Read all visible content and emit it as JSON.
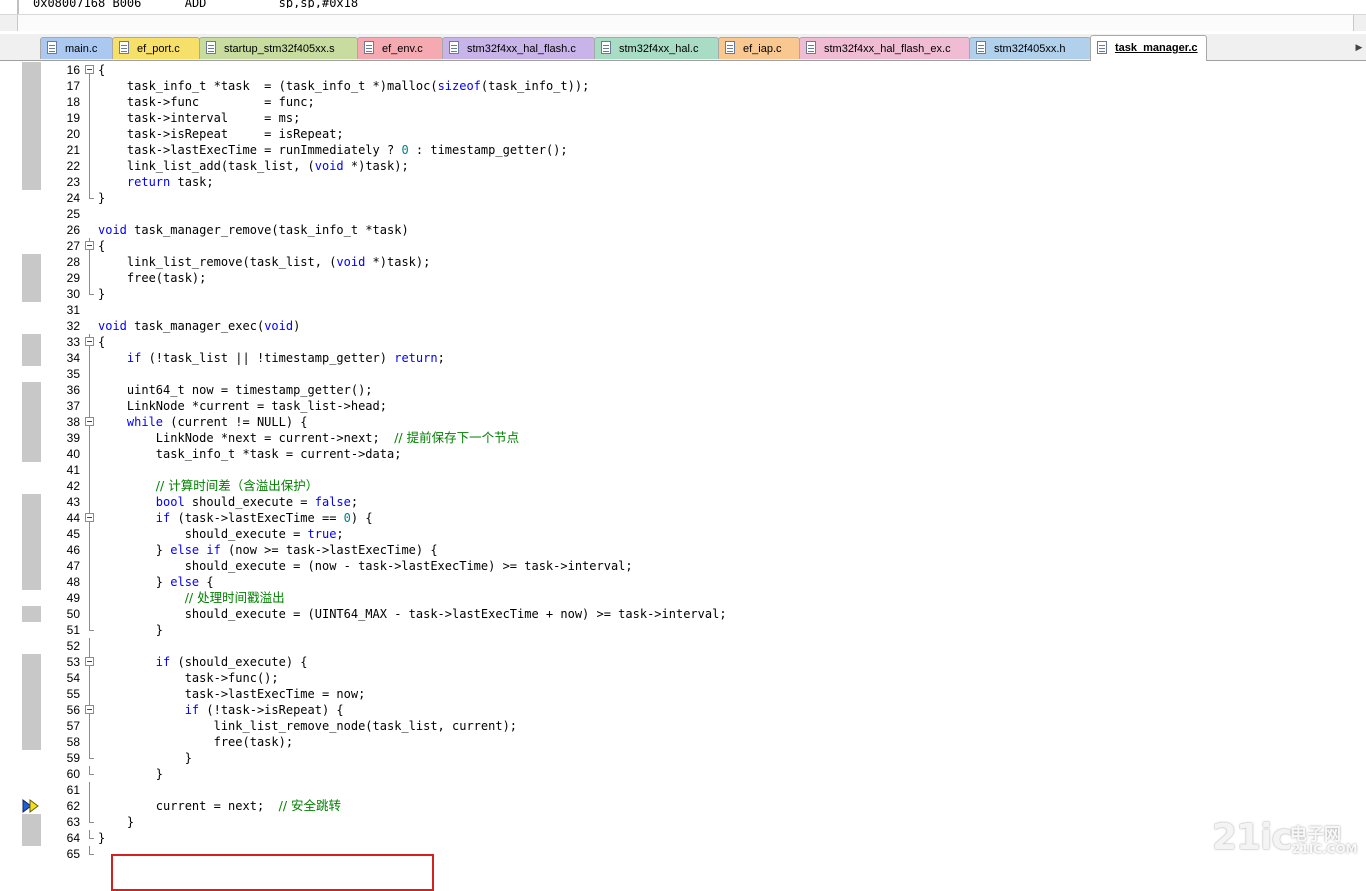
{
  "disassembly": {
    "line": "0x08007168 B006      ADD          sp,sp,#0x18"
  },
  "tabs": [
    {
      "label": "main.c",
      "color": "#aac8f0",
      "active": false
    },
    {
      "label": "ef_port.c",
      "color": "#f7e06a",
      "active": false
    },
    {
      "label": "startup_stm32f405xx.s",
      "color": "#c8dca0",
      "active": false
    },
    {
      "label": "ef_env.c",
      "color": "#f4aab0",
      "active": false
    },
    {
      "label": "stm32f4xx_hal_flash.c",
      "color": "#c8b4e8",
      "active": false
    },
    {
      "label": "stm32f4xx_hal.c",
      "color": "#a8dcc4",
      "active": false
    },
    {
      "label": "ef_iap.c",
      "color": "#f8c890",
      "active": false
    },
    {
      "label": "stm32f4xx_hal_flash_ex.c",
      "color": "#f0bcd4",
      "active": false
    },
    {
      "label": "stm32f405xx.h",
      "color": "#b0d0ec",
      "active": false
    },
    {
      "label": "task_manager.c",
      "color": "#ffffff",
      "active": true
    }
  ],
  "tab_scroll_glyph": "▶",
  "editor": {
    "lines": [
      {
        "n": "16",
        "mark": true,
        "fold": "box",
        "code": [
          [
            "t",
            "{"
          ]
        ]
      },
      {
        "n": "17",
        "mark": true,
        "fold": "line",
        "code": [
          [
            "t",
            "    task_info_t *task  = (task_info_t *)malloc("
          ],
          [
            "k",
            "sizeof"
          ],
          [
            "t",
            "(task_info_t));"
          ]
        ]
      },
      {
        "n": "18",
        "mark": true,
        "fold": "line",
        "code": [
          [
            "t",
            "    task->func         = func;"
          ]
        ]
      },
      {
        "n": "19",
        "mark": true,
        "fold": "line",
        "code": [
          [
            "t",
            "    task->interval     = ms;"
          ]
        ]
      },
      {
        "n": "20",
        "mark": true,
        "fold": "line",
        "code": [
          [
            "t",
            "    task->isRepeat     = isRepeat;"
          ]
        ]
      },
      {
        "n": "21",
        "mark": true,
        "fold": "line",
        "code": [
          [
            "t",
            "    task->lastExecTime = runImmediately ? "
          ],
          [
            "d",
            "0"
          ],
          [
            "t",
            " : timestamp_getter();"
          ]
        ]
      },
      {
        "n": "22",
        "mark": true,
        "fold": "line",
        "code": [
          [
            "t",
            "    link_list_add(task_list, ("
          ],
          [
            "k",
            "void"
          ],
          [
            "t",
            " *)task);"
          ]
        ]
      },
      {
        "n": "23",
        "mark": true,
        "fold": "line",
        "code": [
          [
            "t",
            "    "
          ],
          [
            "k",
            "return"
          ],
          [
            "t",
            " task;"
          ]
        ]
      },
      {
        "n": "24",
        "mark": false,
        "fold": "end",
        "code": [
          [
            "t",
            "}"
          ]
        ]
      },
      {
        "n": "25",
        "mark": false,
        "fold": "",
        "code": []
      },
      {
        "n": "26",
        "mark": false,
        "fold": "",
        "code": [
          [
            "k",
            "void"
          ],
          [
            "t",
            " task_manager_remove(task_info_t *task)"
          ]
        ]
      },
      {
        "n": "27",
        "mark": false,
        "fold": "box",
        "code": [
          [
            "t",
            "{"
          ]
        ]
      },
      {
        "n": "28",
        "mark": true,
        "fold": "line",
        "code": [
          [
            "t",
            "    link_list_remove(task_list, ("
          ],
          [
            "k",
            "void"
          ],
          [
            "t",
            " *)task);"
          ]
        ]
      },
      {
        "n": "29",
        "mark": true,
        "fold": "line",
        "code": [
          [
            "t",
            "    free(task);"
          ]
        ]
      },
      {
        "n": "30",
        "mark": true,
        "fold": "end",
        "code": [
          [
            "t",
            "}"
          ]
        ]
      },
      {
        "n": "31",
        "mark": false,
        "fold": "",
        "code": []
      },
      {
        "n": "32",
        "mark": false,
        "fold": "",
        "code": [
          [
            "k",
            "void"
          ],
          [
            "t",
            " task_manager_exec("
          ],
          [
            "k",
            "void"
          ],
          [
            "t",
            ")"
          ]
        ]
      },
      {
        "n": "33",
        "mark": true,
        "fold": "box",
        "code": [
          [
            "t",
            "{"
          ]
        ]
      },
      {
        "n": "34",
        "mark": true,
        "fold": "line",
        "code": [
          [
            "t",
            "    "
          ],
          [
            "k",
            "if"
          ],
          [
            "t",
            " (!task_list || !timestamp_getter) "
          ],
          [
            "k",
            "return"
          ],
          [
            "t",
            ";"
          ]
        ]
      },
      {
        "n": "35",
        "mark": false,
        "fold": "line",
        "code": []
      },
      {
        "n": "36",
        "mark": true,
        "fold": "line",
        "code": [
          [
            "t",
            "    uint64_t now = timestamp_getter();"
          ]
        ]
      },
      {
        "n": "37",
        "mark": true,
        "fold": "line",
        "code": [
          [
            "t",
            "    LinkNode *current = task_list->head;"
          ]
        ]
      },
      {
        "n": "38",
        "mark": true,
        "fold": "box",
        "code": [
          [
            "t",
            "    "
          ],
          [
            "k",
            "while"
          ],
          [
            "t",
            " (current != NULL) {"
          ]
        ]
      },
      {
        "n": "39",
        "mark": true,
        "fold": "line",
        "code": [
          [
            "t",
            "        LinkNode *next = current->next;  "
          ],
          [
            "c",
            "// 提前保存下一个节点"
          ]
        ]
      },
      {
        "n": "40",
        "mark": true,
        "fold": "line",
        "code": [
          [
            "t",
            "        task_info_t *task = current->data;"
          ]
        ]
      },
      {
        "n": "41",
        "mark": false,
        "fold": "line",
        "code": []
      },
      {
        "n": "42",
        "mark": false,
        "fold": "line",
        "code": [
          [
            "t",
            "        "
          ],
          [
            "c",
            "// 计算时间差（含溢出保护）"
          ]
        ]
      },
      {
        "n": "43",
        "mark": true,
        "fold": "line",
        "code": [
          [
            "t",
            "        "
          ],
          [
            "k",
            "bool"
          ],
          [
            "t",
            " should_execute = "
          ],
          [
            "k",
            "false"
          ],
          [
            "t",
            ";"
          ]
        ]
      },
      {
        "n": "44",
        "mark": true,
        "fold": "box",
        "code": [
          [
            "t",
            "        "
          ],
          [
            "k",
            "if"
          ],
          [
            "t",
            " (task->lastExecTime == "
          ],
          [
            "d",
            "0"
          ],
          [
            "t",
            ") {"
          ]
        ]
      },
      {
        "n": "45",
        "mark": true,
        "fold": "line",
        "code": [
          [
            "t",
            "            should_execute = "
          ],
          [
            "k",
            "true"
          ],
          [
            "t",
            ";"
          ]
        ]
      },
      {
        "n": "46",
        "mark": true,
        "fold": "line",
        "code": [
          [
            "t",
            "        } "
          ],
          [
            "k",
            "else if"
          ],
          [
            "t",
            " (now >= task->lastExecTime) {"
          ]
        ]
      },
      {
        "n": "47",
        "mark": true,
        "fold": "line",
        "code": [
          [
            "t",
            "            should_execute = (now - task->lastExecTime) >= task->interval;"
          ]
        ]
      },
      {
        "n": "48",
        "mark": true,
        "fold": "line",
        "code": [
          [
            "t",
            "        } "
          ],
          [
            "k",
            "else"
          ],
          [
            "t",
            " {"
          ]
        ]
      },
      {
        "n": "49",
        "mark": false,
        "fold": "line",
        "code": [
          [
            "t",
            "            "
          ],
          [
            "c",
            "// 处理时间戳溢出"
          ]
        ]
      },
      {
        "n": "50",
        "mark": true,
        "fold": "line",
        "code": [
          [
            "t",
            "            should_execute = (UINT64_MAX - task->lastExecTime + now) >= task->interval;"
          ]
        ]
      },
      {
        "n": "51",
        "mark": false,
        "fold": "end",
        "code": [
          [
            "t",
            "        }"
          ]
        ]
      },
      {
        "n": "52",
        "mark": false,
        "fold": "line",
        "code": []
      },
      {
        "n": "53",
        "mark": true,
        "fold": "box",
        "code": [
          [
            "t",
            "        "
          ],
          [
            "k",
            "if"
          ],
          [
            "t",
            " (should_execute) {"
          ]
        ]
      },
      {
        "n": "54",
        "mark": true,
        "fold": "line",
        "code": [
          [
            "t",
            "            task->func();"
          ]
        ]
      },
      {
        "n": "55",
        "mark": true,
        "fold": "line",
        "code": [
          [
            "t",
            "            task->lastExecTime = now;"
          ]
        ]
      },
      {
        "n": "56",
        "mark": true,
        "fold": "box",
        "code": [
          [
            "t",
            "            "
          ],
          [
            "k",
            "if"
          ],
          [
            "t",
            " (!task->isRepeat) {"
          ]
        ]
      },
      {
        "n": "57",
        "mark": true,
        "fold": "line",
        "code": [
          [
            "t",
            "                link_list_remove_node(task_list, current);"
          ]
        ]
      },
      {
        "n": "58",
        "mark": true,
        "fold": "line",
        "code": [
          [
            "t",
            "                free(task);"
          ]
        ]
      },
      {
        "n": "59",
        "mark": false,
        "fold": "end",
        "code": [
          [
            "t",
            "            }"
          ]
        ]
      },
      {
        "n": "60",
        "mark": false,
        "fold": "end",
        "code": [
          [
            "t",
            "        }"
          ]
        ]
      },
      {
        "n": "61",
        "mark": false,
        "fold": "line",
        "code": []
      },
      {
        "n": "62",
        "mark": false,
        "fold": "line",
        "arrow": true,
        "code": [
          [
            "t",
            "        current = next;  "
          ],
          [
            "c",
            "// 安全跳转"
          ]
        ]
      },
      {
        "n": "63",
        "mark": true,
        "fold": "end",
        "code": [
          [
            "t",
            "    }"
          ]
        ]
      },
      {
        "n": "64",
        "mark": true,
        "fold": "end",
        "code": [
          [
            "t",
            "}"
          ]
        ]
      },
      {
        "n": "65",
        "mark": false,
        "fold": "end",
        "code": []
      }
    ]
  },
  "colors": {
    "keyword": "#0000ff",
    "number": "#008080",
    "comment": "#008000",
    "highlight_box": "#d32020"
  },
  "watermark": {
    "brand": "21ic",
    "cn": "电子网",
    "url": "21IC.COM"
  }
}
